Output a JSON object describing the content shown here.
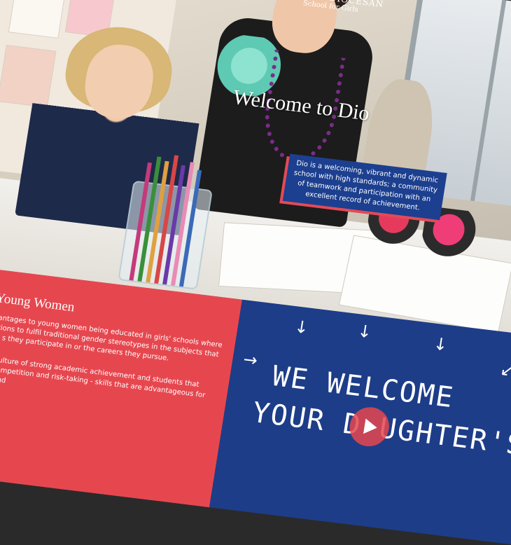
{
  "logo": {
    "name": "WAIKATO DIOCESAN",
    "tagline": "School for Girls"
  },
  "hero": {
    "title": "Welcome to Dio",
    "intro": "Dio is a welcoming, vibrant and dynamic school with high standards; a community of teamwork and participation with an excellent record of achievement."
  },
  "feature": {
    "heading": "ating Young Women",
    "para1": "many advantages to young women being educated in girls' schools where there ectations to fulfil traditional gender stereotypes in the subjects that they study, s they participate in or the careers they pursue.",
    "para2": "e create a culture of strong academic achievement and students that engage in competition and risk-taking - skills that are advantageous for leadership and"
  },
  "video": {
    "line1": "WE WELCOME",
    "line2": "YOUR D  UGHTER'S"
  },
  "colors": {
    "red": "#e6474f",
    "blue": "#1d3d88",
    "box_blue": "#1c3f8f"
  }
}
